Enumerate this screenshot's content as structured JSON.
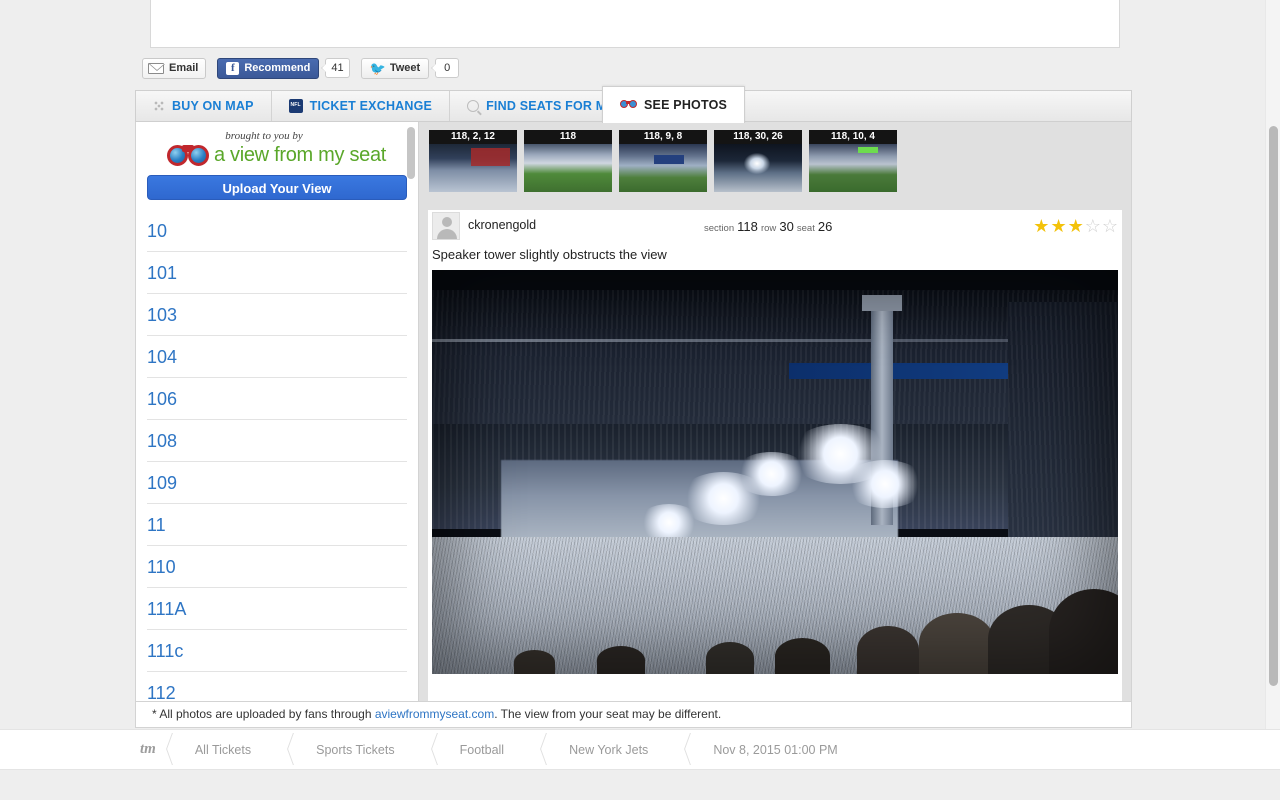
{
  "social": {
    "email_label": "Email",
    "email_icon": "envelope-icon",
    "facebook_label": "Recommend",
    "facebook_count": "41",
    "facebook_icon": "facebook-f-icon",
    "twitter_label": "Tweet",
    "twitter_count": "0",
    "twitter_icon": "twitter-bird-icon"
  },
  "tabs": [
    {
      "label": "BUY ON MAP",
      "icon": "map-grid-icon",
      "active": false
    },
    {
      "label": "TICKET EXCHANGE",
      "icon": "nfl-shield-icon",
      "active": false
    },
    {
      "label": "FIND SEATS FOR ME",
      "icon": "search-icon",
      "active": false
    },
    {
      "label": "SEE PHOTOS",
      "icon": "binoculars-icon",
      "active": true
    }
  ],
  "sidebar": {
    "brought_by": "brought to you by",
    "brand": "a view from my seat",
    "brand_icon": "binoculars-icon",
    "brand_color": "#5aa72a",
    "upload_label": "Upload Your View",
    "upload_color": "#2f68cf",
    "sections": [
      "10",
      "101",
      "103",
      "104",
      "106",
      "108",
      "109",
      "11",
      "110",
      "111A",
      "111c",
      "112"
    ]
  },
  "thumbnails": [
    {
      "label": "118, 2, 12"
    },
    {
      "label": "118"
    },
    {
      "label": "118, 9, 8"
    },
    {
      "label": "118, 30, 26"
    },
    {
      "label": "118, 10, 4"
    }
  ],
  "review": {
    "username": "ckronengold",
    "avatar_icon": "user-avatar-icon",
    "seat_section_label": "section",
    "seat_section_value": "118",
    "seat_row_label": "row",
    "seat_row_value": "30",
    "seat_seat_label": "seat",
    "seat_seat_value": "26",
    "rating": 3,
    "rating_max": 5,
    "star_on_color": "#f3c20a",
    "star_off_color": "#d0d0d0",
    "caption": "Speaker tower slightly obstructs the view",
    "photo_alt": "Night concert view from upper deck with speaker tower obstructing stage"
  },
  "disclaimer": {
    "prefix": "* All photos are uploaded by fans through ",
    "link": "aviewfrommyseat.com",
    "suffix": ". The view from your seat may be different."
  },
  "footer": {
    "logo": "tm",
    "crumbs": [
      "All Tickets",
      "Sports Tickets",
      "Football",
      "New York Jets",
      "Nov 8, 2015 01:00 PM"
    ]
  }
}
